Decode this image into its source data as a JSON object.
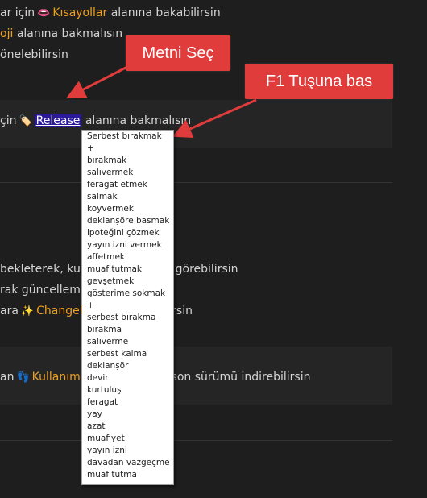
{
  "content": {
    "line1": {
      "prefix": "ar için",
      "icon": "lips-icon",
      "link": "Kısayollar",
      "suffix": "alanına bakabilirsin"
    },
    "line2": {
      "link": "oji",
      "suffix": "alanına bakmalısın"
    },
    "line3": {
      "text": "önelebilirsin"
    },
    "release_line": {
      "prefix": "çin",
      "icon": "tag-icon",
      "selected": "Release",
      "suffix": "alanına bakmalısın"
    },
    "line5": {
      "prefix": "bekleterek, kull",
      "suffix": "görebilirsin"
    },
    "line6": {
      "text": "rak güncelleme"
    },
    "line7": {
      "prefix": "ara",
      "icon": "sparkles-icon",
      "link": "Changel",
      "suffix": "bilirsin"
    },
    "line8": {
      "prefix": "an",
      "icon": "footprints-icon",
      "link": "Kullanım",
      "suffix": "dan son sürümü indirebilirsin"
    }
  },
  "callouts": {
    "select_text": "Metni Seç",
    "press_f1": "F1 Tuşuna bas"
  },
  "context_menu": {
    "items": [
      "Serbest bırakmak",
      "+",
      "bırakmak",
      "salıvermek",
      "feragat etmek",
      "salmak",
      "koyvermek",
      "deklanşöre basmak",
      "ipoteğini çözmek",
      "yayın izni vermek",
      "affetmek",
      "muaf tutmak",
      "gevşetmek",
      "gösterime sokmak",
      "+",
      "serbest bırakma",
      "bırakma",
      "salıverme",
      "serbest kalma",
      "deklanşör",
      "devir",
      "kurtuluş",
      "feragat",
      "yay",
      "azat",
      "muafiyet",
      "yayın izni",
      "davadan vazgeçme",
      "muaf tutma"
    ]
  },
  "colors": {
    "background": "#1e1e1e",
    "link": "#f0a020",
    "callout": "#e03c3c",
    "selection": "#2a1a9a"
  }
}
